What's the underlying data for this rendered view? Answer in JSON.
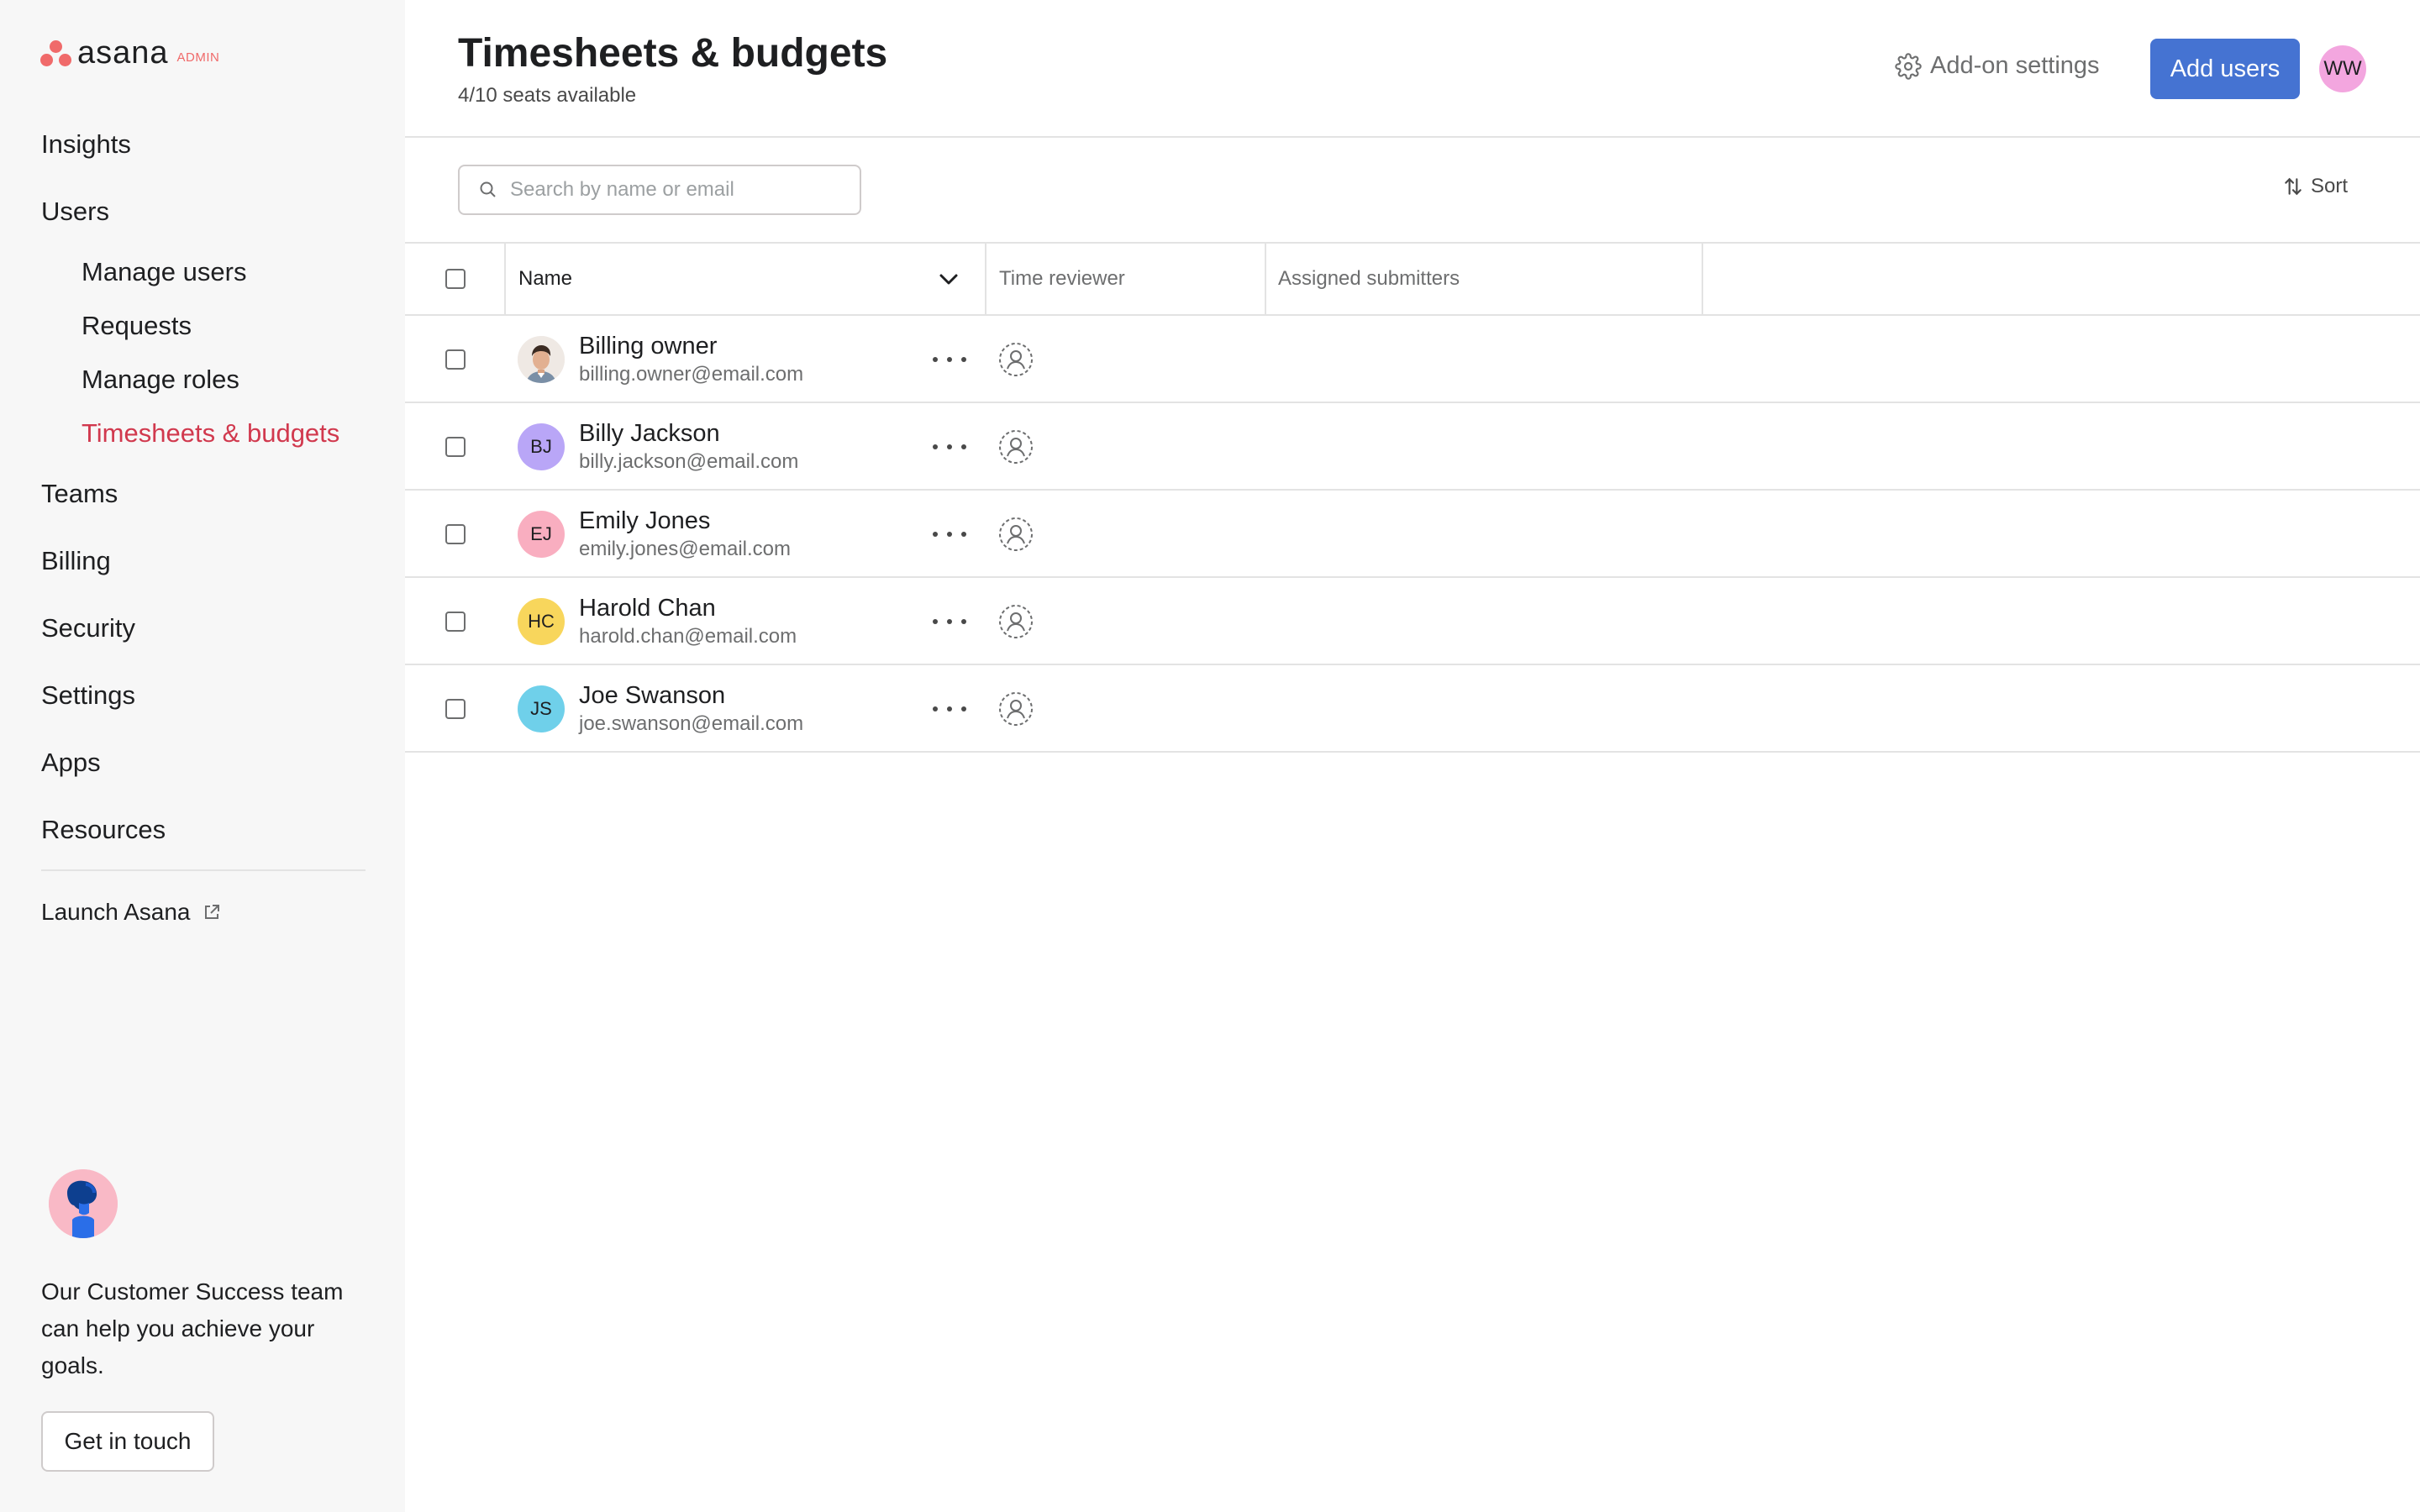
{
  "brand": {
    "name": "asana",
    "badge": "ADMIN",
    "accent": "#f06a6a"
  },
  "nav": {
    "insights": "Insights",
    "users": "Users",
    "manage_users": "Manage users",
    "requests": "Requests",
    "manage_roles": "Manage roles",
    "timesheets": "Timesheets & budgets",
    "teams": "Teams",
    "billing": "Billing",
    "security": "Security",
    "settings": "Settings",
    "apps": "Apps",
    "resources": "Resources",
    "launch": "Launch Asana",
    "active_color": "#d1394e"
  },
  "promo": {
    "text": "Our Customer Success team can help you achieve your goals.",
    "button": "Get in touch"
  },
  "header": {
    "title": "Timesheets & budgets",
    "subtitle": "4/10 seats available",
    "addon_settings": "Add-on settings",
    "add_users": "Add users",
    "user_initials": "WW",
    "primary_color": "#4573d2"
  },
  "toolbar": {
    "search_placeholder": "Search by name or email",
    "sort": "Sort"
  },
  "table": {
    "columns": {
      "name": "Name",
      "time_reviewer": "Time reviewer",
      "assigned_submitters": "Assigned submitters"
    },
    "rows": [
      {
        "name": "Billing owner",
        "email": "billing.owner@email.com",
        "initials": "",
        "avatar_color": "#f3f3f3"
      },
      {
        "name": "Billy Jackson",
        "email": "billy.jackson@email.com",
        "initials": "BJ",
        "avatar_color": "#b9a6f7"
      },
      {
        "name": "Emily Jones",
        "email": "emily.jones@email.com",
        "initials": "EJ",
        "avatar_color": "#f9aec0"
      },
      {
        "name": "Harold Chan",
        "email": "harold.chan@email.com",
        "initials": "HC",
        "avatar_color": "#f8d65c"
      },
      {
        "name": "Joe Swanson",
        "email": "joe.swanson@email.com",
        "initials": "JS",
        "avatar_color": "#6fd0ea"
      }
    ]
  }
}
